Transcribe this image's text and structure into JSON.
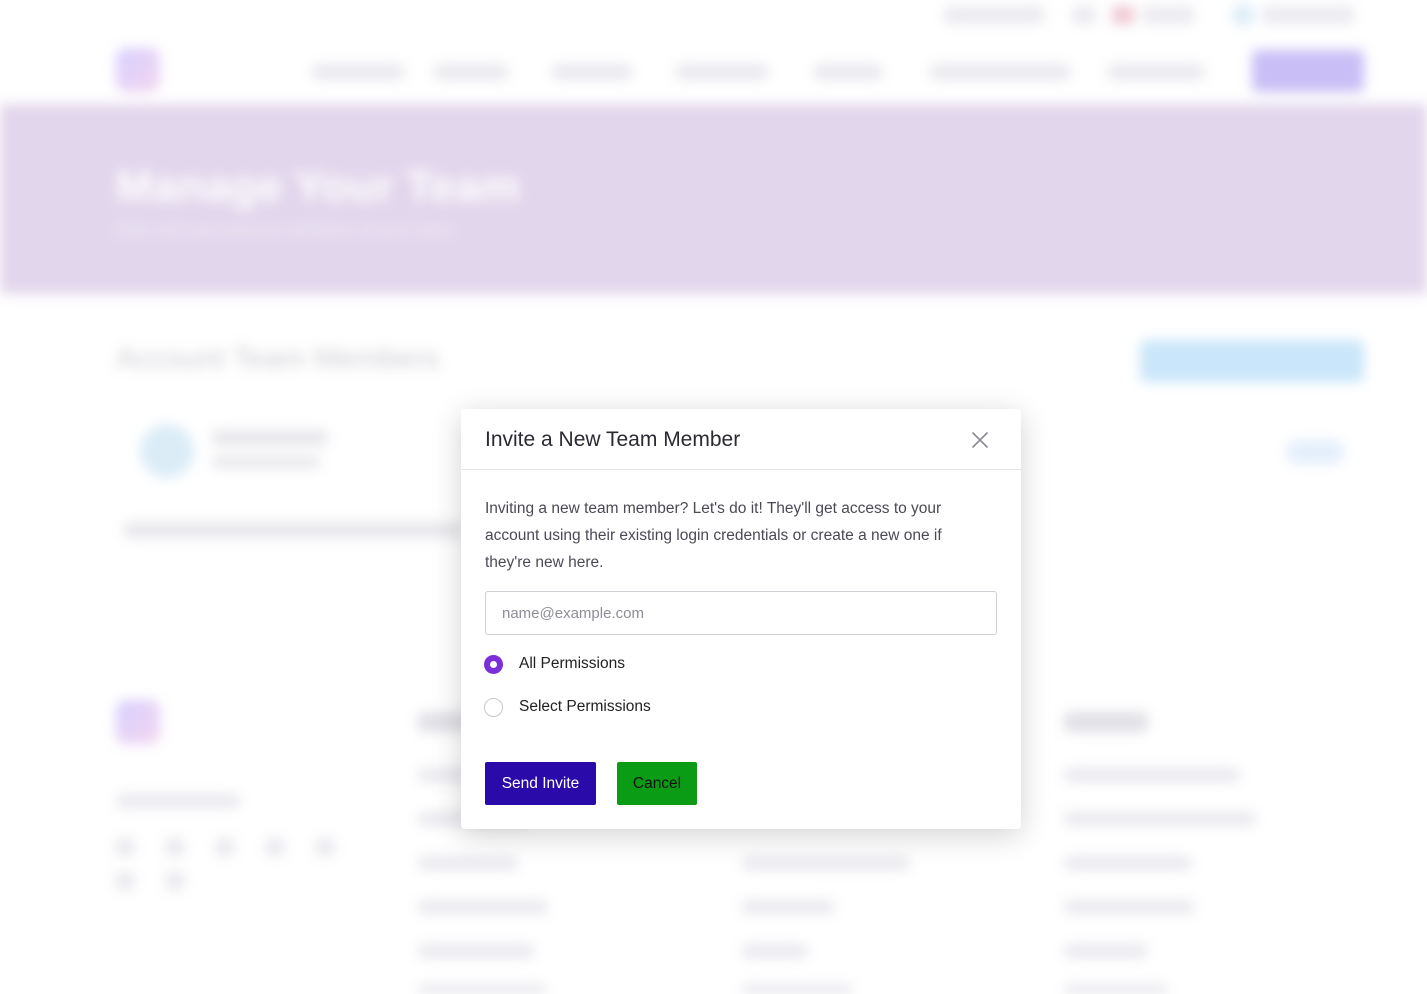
{
  "background": {
    "hero": {
      "title": "Manage Your Team",
      "subtitle": "Add, edit and remove members of your team"
    },
    "section": {
      "title": "Account Team Members"
    }
  },
  "modal": {
    "title": "Invite a New Team Member",
    "description": "Inviting a new team member? Let's do it! They'll get access to your account using their existing login credentials or create a new one if they're new here.",
    "email": {
      "value": "",
      "placeholder": "name@example.com"
    },
    "permissions": [
      {
        "label": "All Permissions",
        "selected": true
      },
      {
        "label": "Select Permissions",
        "selected": false
      }
    ],
    "send_label": "Send Invite",
    "cancel_label": "Cancel",
    "close_icon": "close-icon"
  },
  "colors": {
    "accent": "#7b2fd8",
    "send_button": "#2a0aa8",
    "cancel_button": "#0a9c14",
    "hero_bg": "#d8c9e6"
  }
}
